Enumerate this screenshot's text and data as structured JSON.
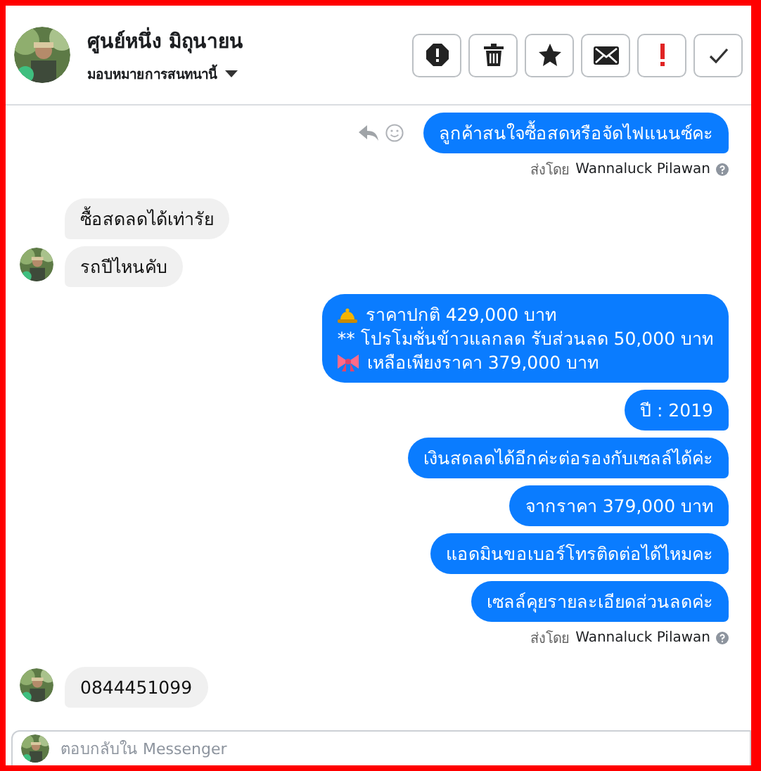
{
  "header": {
    "name": "ศูนย์หนึ่ง มิถุนายน",
    "assign_label": "มอบหมายการสนทนานี้",
    "actions": [
      {
        "kind": "spam"
      },
      {
        "kind": "delete"
      },
      {
        "kind": "star"
      },
      {
        "kind": "unread"
      },
      {
        "kind": "important"
      },
      {
        "kind": "done"
      }
    ]
  },
  "messages": [
    {
      "kind": "outgoing",
      "hover_actions": true,
      "lines": [
        {
          "text": "ลูกค้าสนใจซื้อสดหรือจัดไฟแนนซ์คะ"
        }
      ]
    },
    {
      "kind": "sent-by",
      "label": "ส่งโดย",
      "name": "Wannaluck Pilawan"
    },
    {
      "kind": "incoming",
      "avatar": false,
      "lines": [
        {
          "text": "ซื้อสดลดได้เท่ารัย"
        }
      ]
    },
    {
      "kind": "incoming",
      "avatar": true,
      "lines": [
        {
          "text": "รถปีไหนคับ"
        }
      ]
    },
    {
      "kind": "outgoing",
      "hover_actions": false,
      "lines": [
        {
          "kind": "bell",
          "text": "ราคาปกติ 429,000 บาท"
        },
        {
          "kind": "plain",
          "text": "** โปรโมชั่นข้าวแลกลด รับส่วนลด 50,000 บาท"
        },
        {
          "kind": "bow",
          "text": "เหลือเพียงราคา 379,000 บาท"
        }
      ]
    },
    {
      "kind": "outgoing",
      "hover_actions": false,
      "lines": [
        {
          "text": "ปี : 2019"
        }
      ]
    },
    {
      "kind": "outgoing",
      "hover_actions": false,
      "lines": [
        {
          "text": "เงินสดลดได้อีกค่ะต่อรองกับเซลล์ได้ค่ะ"
        }
      ]
    },
    {
      "kind": "outgoing",
      "hover_actions": false,
      "lines": [
        {
          "text": "จากราคา 379,000 บาท"
        }
      ]
    },
    {
      "kind": "outgoing",
      "hover_actions": false,
      "lines": [
        {
          "text": "แอดมินขอเบอร์โทรติดต่อได้ไหมคะ"
        }
      ]
    },
    {
      "kind": "outgoing",
      "hover_actions": false,
      "lines": [
        {
          "text": "เซลล์คุยรายละเอียดส่วนลดค่ะ"
        }
      ]
    },
    {
      "kind": "sent-by",
      "label": "ส่งโดย",
      "name": "Wannaluck Pilawan"
    },
    {
      "kind": "incoming",
      "avatar": true,
      "lines": [
        {
          "text": "0844451099"
        }
      ]
    }
  ],
  "composer": {
    "placeholder": "ตอบกลับใน Messenger"
  }
}
